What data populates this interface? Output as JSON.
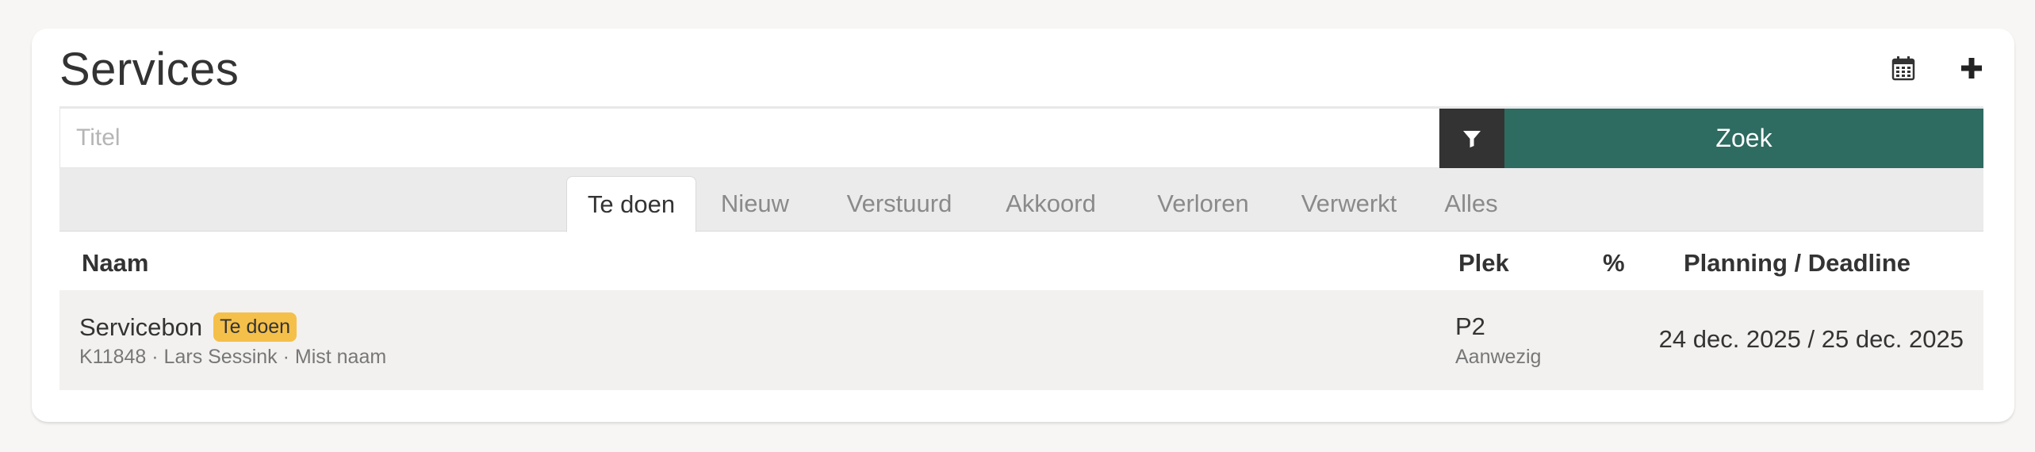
{
  "header": {
    "title": "Services",
    "icons": [
      "calendar-icon",
      "plus-icon"
    ]
  },
  "search": {
    "placeholder": "Titel",
    "value": "",
    "filter_icon": "filter-icon",
    "button_label": "Zoek"
  },
  "tabs": [
    {
      "label": "Te doen",
      "active": true
    },
    {
      "label": "Nieuw",
      "active": false
    },
    {
      "label": "Verstuurd",
      "active": false
    },
    {
      "label": "Akkoord",
      "active": false
    },
    {
      "label": "Verloren",
      "active": false
    },
    {
      "label": "Verwerkt",
      "active": false
    },
    {
      "label": "Alles",
      "active": false
    }
  ],
  "table": {
    "columns": [
      "Naam",
      "Plek",
      "%",
      "Planning / Deadline"
    ],
    "rows": [
      {
        "name": "Servicebon",
        "status": "Te doen",
        "meta": "K11848 · Lars Sessink  · Mist naam",
        "plek": "P2",
        "plek_status": "Aanwezig",
        "percentage": "",
        "planning": "24 dec. 2025 / 25 dec. 2025"
      }
    ]
  },
  "colors": {
    "accent": "#2e6b61",
    "filter_button": "#333333",
    "badge": "#f5c04a",
    "background": "#f7f6f4"
  }
}
